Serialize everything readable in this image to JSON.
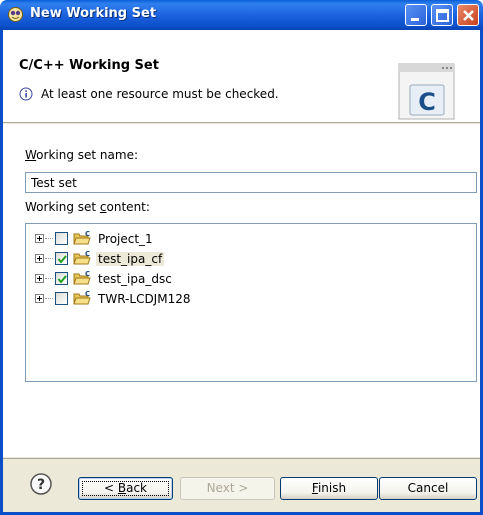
{
  "window": {
    "title": "New Working Set"
  },
  "banner": {
    "heading": "C/C++ Working Set",
    "message": "At least one resource must be checked.",
    "wizard_image_letter": "C"
  },
  "form": {
    "name_label_mnemonic": "W",
    "name_label_rest": "orking set name:",
    "name_value": "Test set",
    "content_label_start": "Working set ",
    "content_label_mnemonic": "c",
    "content_label_rest": "ontent:"
  },
  "tree": {
    "items": [
      {
        "label": "Project_1",
        "checked": false,
        "selected": false
      },
      {
        "label": "test_ipa_cf",
        "checked": true,
        "selected": true
      },
      {
        "label": "test_ipa_dsc",
        "checked": true,
        "selected": false
      },
      {
        "label": "TWR-LCDJM128",
        "checked": false,
        "selected": false
      }
    ]
  },
  "buttons": {
    "back_mnemonic": "B",
    "back_prefix": "< ",
    "back_rest": "ack",
    "next": "Next >",
    "finish_mnemonic": "F",
    "finish_rest": "inish",
    "cancel": "Cancel"
  },
  "colors": {
    "titlebar": "#1d63e0",
    "dialog_bg": "#ece9d8",
    "selection_bg": "#ece9d8",
    "checkmark": "#21a121"
  }
}
